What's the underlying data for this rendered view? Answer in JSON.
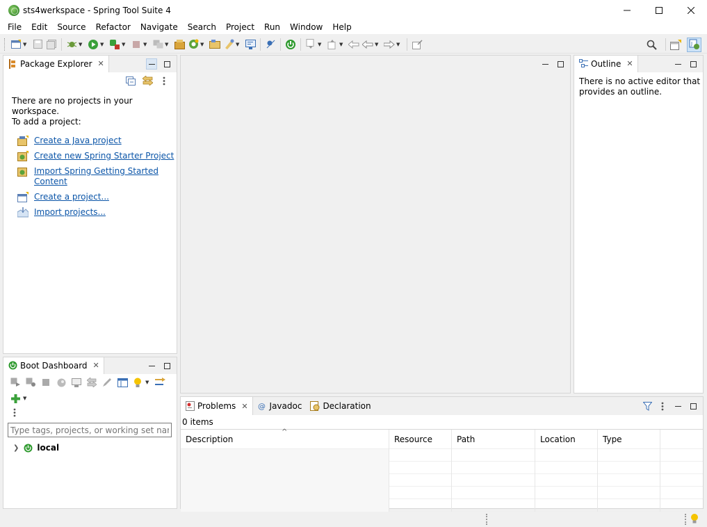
{
  "window": {
    "title": "sts4werkspace - Spring Tool Suite 4"
  },
  "menu": [
    "File",
    "Edit",
    "Source",
    "Refactor",
    "Navigate",
    "Search",
    "Project",
    "Run",
    "Window",
    "Help"
  ],
  "package_explorer": {
    "tab": "Package Explorer",
    "message_line1": "There are no projects in your workspace.",
    "message_line2": "To add a project:",
    "links": [
      {
        "label": "Create a Java project",
        "icon": "java-project-icon"
      },
      {
        "label": "Create new Spring Starter Project",
        "icon": "spring-starter-icon"
      },
      {
        "label": "Import Spring Getting Started",
        "label2": "Content",
        "icon": "spring-guide-icon"
      },
      {
        "label": "Create a project...",
        "icon": "new-project-icon"
      },
      {
        "label": "Import projects...",
        "icon": "import-icon"
      }
    ]
  },
  "outline": {
    "tab": "Outline",
    "message_line1": "There is no active editor that",
    "message_line2": "provides an outline."
  },
  "boot_dashboard": {
    "tab": "Boot Dashboard",
    "filter_placeholder": "Type tags, projects, or working set names",
    "tree_item": "local"
  },
  "problems": {
    "tabs": [
      "Problems",
      "Javadoc",
      "Declaration"
    ],
    "items_count": "0 items",
    "columns": [
      "Description",
      "Resource",
      "Path",
      "Location",
      "Type"
    ]
  },
  "colors": {
    "link": "#0b55a8",
    "spring_green": "#3c8d2f"
  }
}
